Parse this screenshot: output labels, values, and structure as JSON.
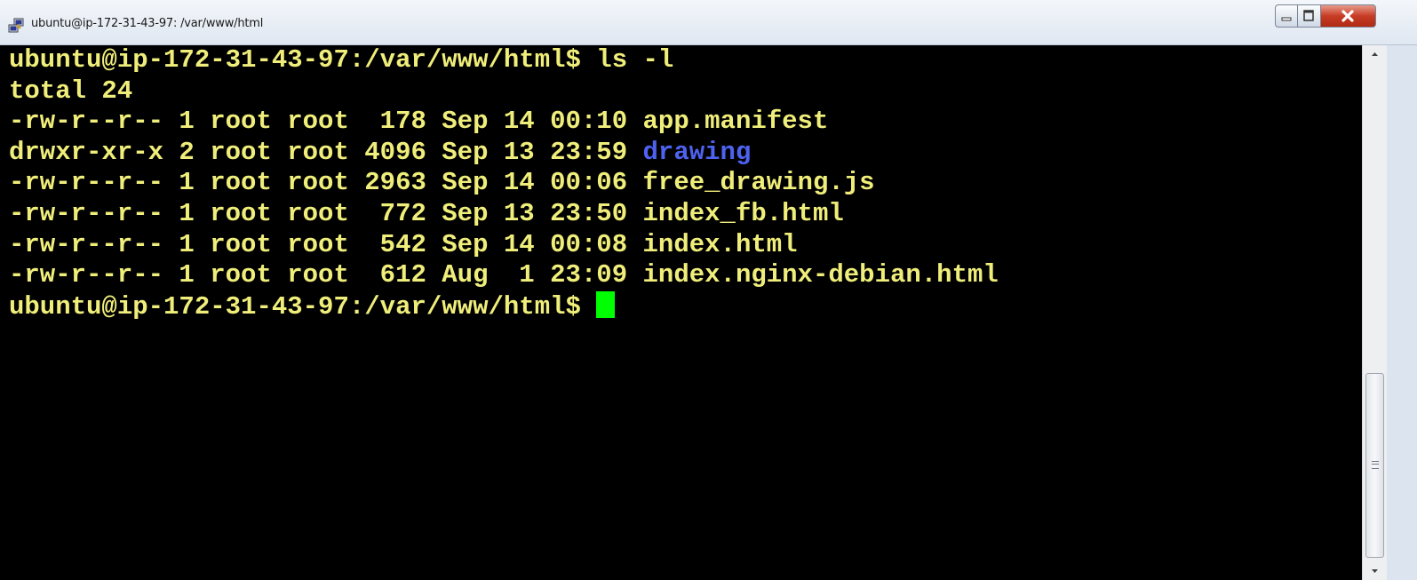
{
  "window": {
    "title": "ubuntu@ip-172-31-43-97: /var/www/html",
    "icon": "putty-icon",
    "controls": {
      "minimize": "minimize-icon",
      "maximize": "maximize-icon",
      "close": "close-icon"
    }
  },
  "terminal": {
    "colors": {
      "background": "#000000",
      "text": "#f0ee7a",
      "directory": "#4e62f0",
      "cursor": "#00ff00"
    },
    "command_line": {
      "prompt": "ubuntu@ip-172-31-43-97:/var/www/html$",
      "command": " ls -l"
    },
    "total": "total 24",
    "listing": [
      {
        "info": "-rw-r--r-- 1 root root  178 Sep 14 00:10 ",
        "name": "app.manifest",
        "is_dir": false
      },
      {
        "info": "drwxr-xr-x 2 root root 4096 Sep 13 23:59 ",
        "name": "drawing",
        "is_dir": true
      },
      {
        "info": "-rw-r--r-- 1 root root 2963 Sep 14 00:06 ",
        "name": "free_drawing.js",
        "is_dir": false
      },
      {
        "info": "-rw-r--r-- 1 root root  772 Sep 13 23:50 ",
        "name": "index_fb.html",
        "is_dir": false
      },
      {
        "info": "-rw-r--r-- 1 root root  542 Sep 14 00:08 ",
        "name": "index.html",
        "is_dir": false
      },
      {
        "info": "-rw-r--r-- 1 root root  612 Aug  1 23:09 ",
        "name": "index.nginx-debian.html",
        "is_dir": false
      }
    ],
    "current_prompt": "ubuntu@ip-172-31-43-97:/var/www/html$ "
  }
}
